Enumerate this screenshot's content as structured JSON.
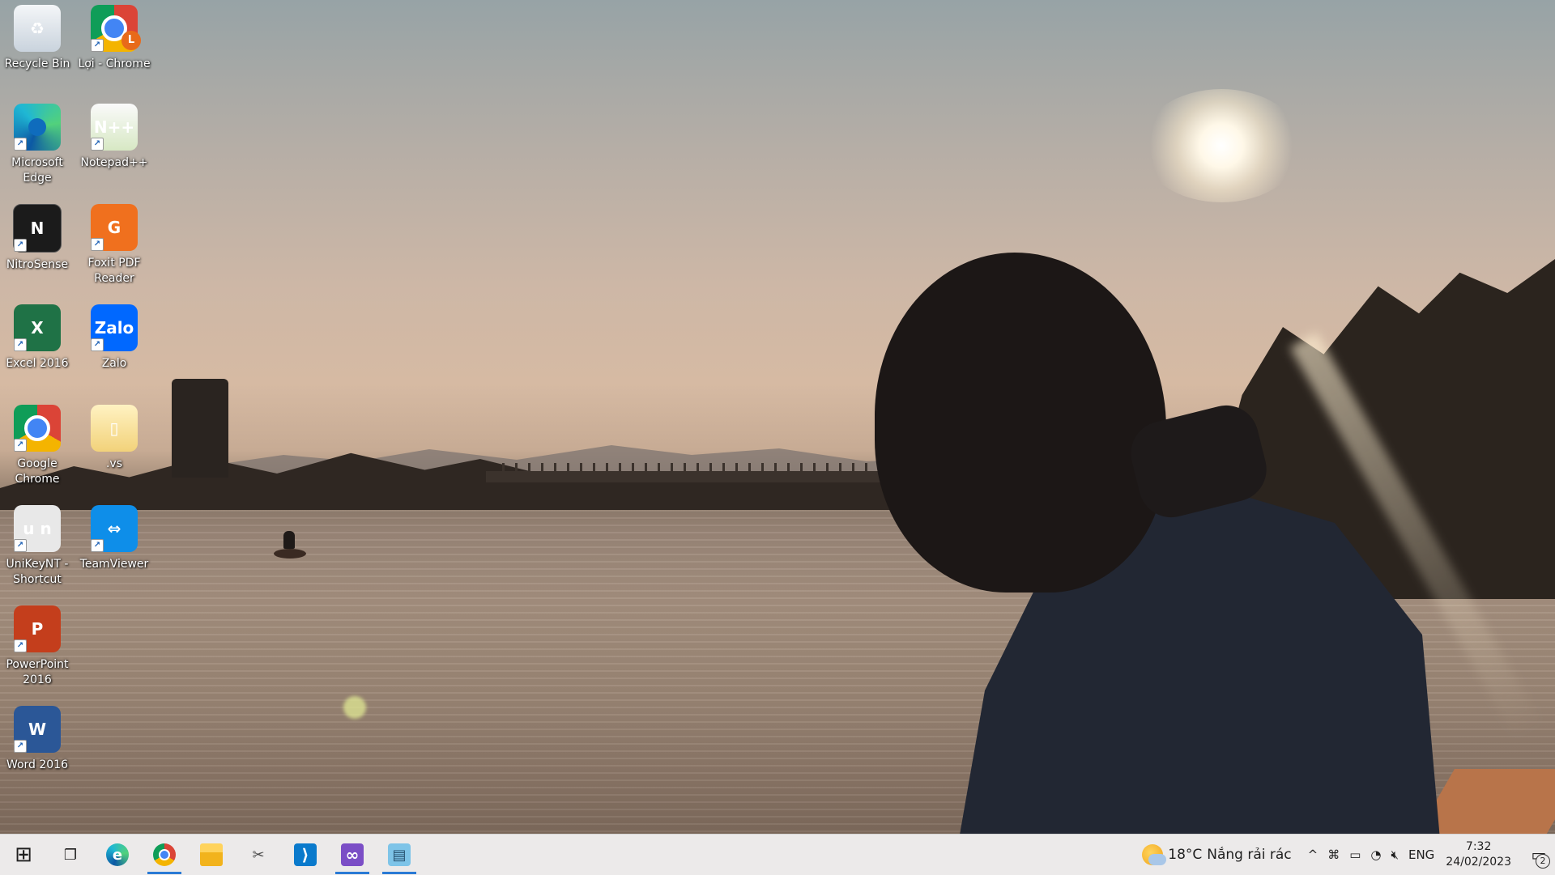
{
  "desktop": {
    "icons": [
      {
        "label": "Recycle Bin",
        "glyph": "♻",
        "icon": "recycle-bin-icon"
      },
      {
        "label": "Lợi - Chrome",
        "glyph": "L",
        "icon": "chrome-profile-icon"
      },
      {
        "label": "Microsoft Edge",
        "glyph": "e",
        "icon": "edge-icon"
      },
      {
        "label": "Notepad++",
        "glyph": "N++",
        "icon": "notepad-plus-plus-icon"
      },
      {
        "label": "NitroSense",
        "glyph": "N",
        "icon": "nitrosense-icon"
      },
      {
        "label": "Foxit PDF Reader",
        "glyph": "G",
        "icon": "foxit-pdf-icon"
      },
      {
        "label": "Excel 2016",
        "glyph": "X",
        "icon": "excel-icon"
      },
      {
        "label": "Zalo",
        "glyph": "Zalo",
        "icon": "zalo-icon"
      },
      {
        "label": "Google Chrome",
        "glyph": "",
        "icon": "chrome-icon"
      },
      {
        "label": ".vs",
        "glyph": "",
        "icon": "folder-icon"
      },
      {
        "label": "UniKeyNT - Shortcut",
        "glyph": "u n",
        "icon": "unikey-icon"
      },
      {
        "label": "TeamViewer",
        "glyph": "⇔",
        "icon": "teamviewer-icon"
      },
      {
        "label": "PowerPoint 2016",
        "glyph": "P",
        "icon": "powerpoint-icon"
      },
      {
        "label": "Word 2016",
        "glyph": "W",
        "icon": "word-icon"
      }
    ]
  },
  "taskbar": {
    "apps": [
      {
        "name": "start-button",
        "glyph": "⊞"
      },
      {
        "name": "task-view-button",
        "glyph": "❐"
      },
      {
        "name": "edge-taskbar",
        "glyph": "e"
      },
      {
        "name": "chrome-taskbar",
        "glyph": ""
      },
      {
        "name": "file-explorer-taskbar",
        "glyph": ""
      },
      {
        "name": "snipping-tool-taskbar",
        "glyph": "✂"
      },
      {
        "name": "vscode-taskbar",
        "glyph": "⟩"
      },
      {
        "name": "visual-studio-taskbar",
        "glyph": "∞"
      },
      {
        "name": "notepad-taskbar",
        "glyph": "▤"
      }
    ],
    "weather": {
      "temp": "18°C",
      "condition": "Nắng rải rác"
    },
    "tray": {
      "chevron": "^",
      "language": "ENG",
      "notification_count": "2"
    },
    "clock": {
      "time": "7:32",
      "date": "24/02/2023"
    }
  }
}
